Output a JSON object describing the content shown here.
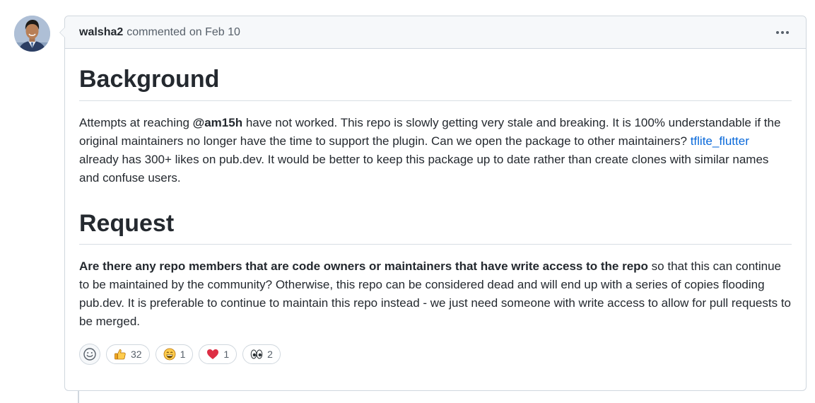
{
  "comment": {
    "author": "walsha2",
    "action": "commented",
    "date": "on Feb 10",
    "menu_icon": "kebab-horizontal-icon"
  },
  "body": {
    "heading1": "Background",
    "p1_part1": "Attempts at reaching ",
    "p1_mention": "@am15h",
    "p1_part2": " have not worked. This repo is slowly getting very stale and breaking. It is 100% understandable if the original maintainers no longer have the time to support the plugin. Can we open the package to other maintainers? ",
    "p1_link": "tflite_flutter",
    "p1_part3": " already has 300+ likes on pub.dev. It would be better to keep this package up to date rather than create clones with similar names and confuse users.",
    "heading2": "Request",
    "p2_bold": "Are there any repo members that are code owners or maintainers that have write access to the repo",
    "p2_rest": " so that this can continue to be maintained by the community? Otherwise, this repo can be considered dead and will end up with a series of copies flooding pub.dev. It is preferable to continue to maintain this repo instead - we just need someone with write access to allow for pull requests to be merged."
  },
  "reactions": {
    "add_icon": "smiley-icon",
    "items": [
      {
        "icon": "thumbs-up-icon",
        "count": "32"
      },
      {
        "icon": "laugh-icon",
        "count": "1"
      },
      {
        "icon": "heart-icon",
        "count": "1"
      },
      {
        "icon": "eyes-icon",
        "count": "2"
      }
    ]
  },
  "colors": {
    "link": "#0969da",
    "border": "#d0d7de",
    "header_bg": "#f6f8fa",
    "text": "#24292f",
    "muted": "#57606a"
  }
}
